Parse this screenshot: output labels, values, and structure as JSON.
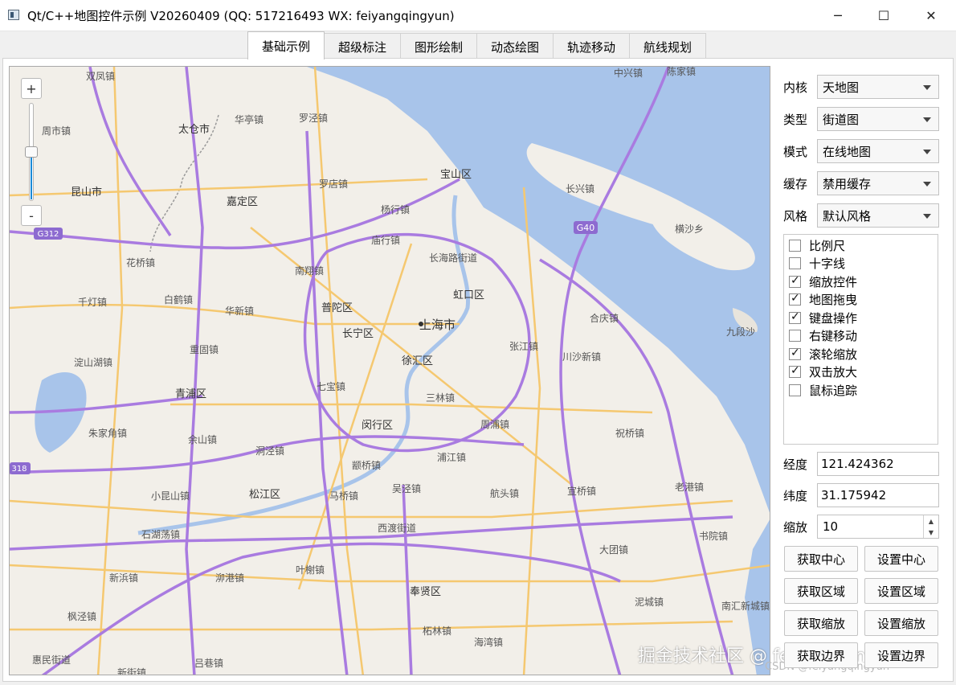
{
  "window": {
    "title": "Qt/C++地图控件示例 V20260409 (QQ: 517216493 WX: feiyangqingyun)",
    "minimize_glyph": "─",
    "maximize_glyph": "☐",
    "close_glyph": "✕"
  },
  "tabs": [
    {
      "label": "基础示例",
      "active": true
    },
    {
      "label": "超级标注",
      "active": false
    },
    {
      "label": "图形绘制",
      "active": false
    },
    {
      "label": "动态绘图",
      "active": false
    },
    {
      "label": "轨迹移动",
      "active": false
    },
    {
      "label": "航线规划",
      "active": false
    }
  ],
  "map": {
    "zoom_in": "+",
    "zoom_out": "-",
    "zoom_level_fraction": 0.5,
    "labels": {
      "shanghai": "上海市",
      "jiading": "嘉定区",
      "baoshan": "宝山区",
      "putuo": "普陀区",
      "changning": "长宁区",
      "xuhui": "徐汇区",
      "hongkou": "虹口区",
      "minhang": "闵行区",
      "songjiang": "松江区",
      "qingpu": "青浦区",
      "fengxian": "奉贤区",
      "taicang": "太仓市",
      "kunshan": "昆山市",
      "zhoushi": "周市镇",
      "shuangfeng": "双凤镇",
      "huating": "华亭镇",
      "luojing": "罗泾镇",
      "luodian": "罗店镇",
      "yanghang": "杨行镇",
      "miaohang": "庙行镇",
      "changxinglu": "长海路街道",
      "nanxiang": "南翔镇",
      "huaqiao": "花桥镇",
      "qiandeng": "千灯镇",
      "baihe": "白鹤镇",
      "huaxin": "华新镇",
      "chonggu": "重固镇",
      "dianshanhu": "淀山湖镇",
      "zhujiajiao": "朱家角镇",
      "yushan": "余山镇",
      "dongjing": "洞泾镇",
      "qibao": "七宝镇",
      "xinzhuang": "颛桥镇",
      "sanlin": "三林镇",
      "zhoupu": "周浦镇",
      "pujiang": "浦江镇",
      "zhangjiang": "张江镇",
      "chuansha": "川沙新镇",
      "heqing": "合庆镇",
      "zhuqiao": "祝桥镇",
      "xiaokunshan": "小昆山镇",
      "majiao": "马桥镇",
      "wujing": "吴泾镇",
      "hangtou": "航头镇",
      "xuanqiao": "宣桥镇",
      "laogang": "老港镇",
      "shihudang": "石湖荡镇",
      "xindu": "西渡街道",
      "shubao": "书院镇",
      "datuan": "大团镇",
      "xinbin": "新浜镇",
      "maogang": "泖港镇",
      "yeshi": "叶榭镇",
      "nihui": "泥城镇",
      "nanhui": "南汇新城镇",
      "fengjing": "枫泾镇",
      "tinglin": "柘林镇",
      "haiwan": "海湾镇",
      "huimin": "惠民街道",
      "xinjie": "新街镇",
      "lvxiang": "吕巷镇",
      "changxing": "长兴镇",
      "hengsha": "横沙乡",
      "jiuduan": "九段沙",
      "zhongxing": "中兴镇",
      "chenjia": "陈家镇",
      "g40": "G40",
      "g312": "G312",
      "road318": "318"
    }
  },
  "panel": {
    "kernel": {
      "label": "内核",
      "value": "天地图"
    },
    "type": {
      "label": "类型",
      "value": "街道图"
    },
    "mode": {
      "label": "模式",
      "value": "在线地图"
    },
    "cache": {
      "label": "缓存",
      "value": "禁用缓存"
    },
    "style": {
      "label": "风格",
      "value": "默认风格"
    },
    "checks": [
      {
        "label": "比例尺",
        "checked": false
      },
      {
        "label": "十字线",
        "checked": false
      },
      {
        "label": "缩放控件",
        "checked": true
      },
      {
        "label": "地图拖曳",
        "checked": true
      },
      {
        "label": "键盘操作",
        "checked": true
      },
      {
        "label": "右键移动",
        "checked": false
      },
      {
        "label": "滚轮缩放",
        "checked": true
      },
      {
        "label": "双击放大",
        "checked": true
      },
      {
        "label": "鼠标追踪",
        "checked": false
      }
    ],
    "lng": {
      "label": "经度",
      "value": "121.424362"
    },
    "lat": {
      "label": "纬度",
      "value": "31.175942"
    },
    "zoom": {
      "label": "缩放",
      "value": "10"
    },
    "buttons": {
      "get_center": "获取中心",
      "set_center": "设置中心",
      "get_area": "获取区域",
      "set_area": "设置区域",
      "get_zoom": "获取缩放",
      "set_zoom": "设置缩放",
      "get_bounds": "获取边界",
      "set_bounds": "设置边界"
    }
  },
  "watermark": {
    "text": "掘金技术社区 @ feiyangqingyun",
    "small": "CSDN @feiyangqingyun"
  },
  "colors": {
    "water": "#a8c4ea",
    "land": "#f2efe9",
    "expressway": "#a97be0",
    "mainroad": "#f5c870",
    "accent": "#1a8ad8"
  }
}
